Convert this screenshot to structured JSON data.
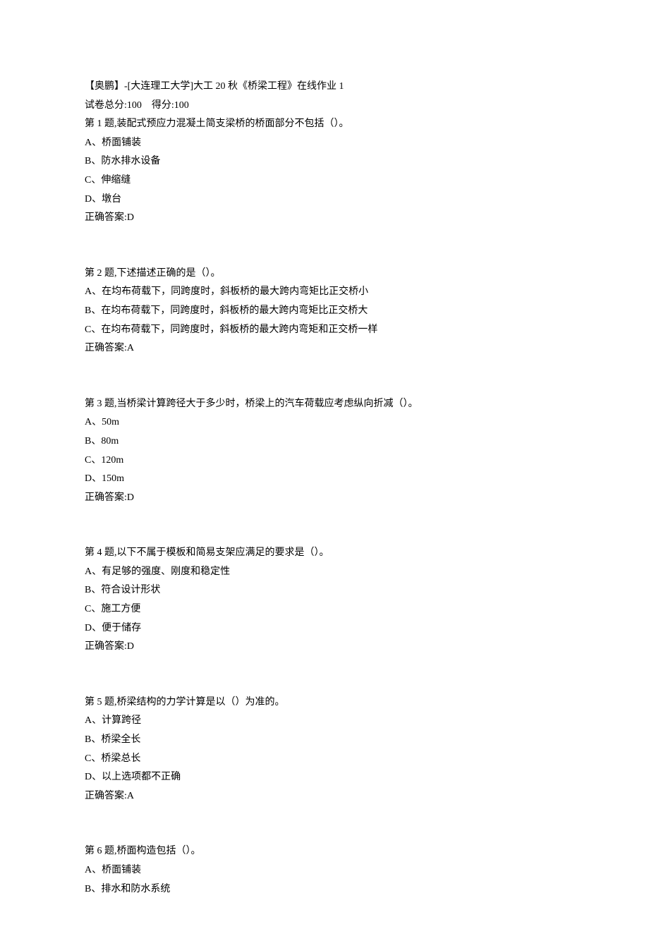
{
  "header": {
    "title_line": "【奥鹏】-[大连理工大学]大工 20 秋《桥梁工程》在线作业 1",
    "score_line": "试卷总分:100    得分:100"
  },
  "questions": [
    {
      "stem": "第 1 题,装配式预应力混凝土简支梁桥的桥面部分不包括（）。",
      "options": [
        "A、桥面铺装",
        "B、防水排水设备",
        "C、伸缩缝",
        "D、墩台"
      ],
      "answer": "正确答案:D"
    },
    {
      "stem": "第 2 题,下述描述正确的是（）。",
      "options": [
        "A、在均布荷载下，同跨度时，斜板桥的最大跨内弯矩比正交桥小",
        "B、在均布荷载下，同跨度时，斜板桥的最大跨内弯矩比正交桥大",
        "C、在均布荷载下，同跨度时，斜板桥的最大跨内弯矩和正交桥一样"
      ],
      "answer": "正确答案:A"
    },
    {
      "stem": "第 3 题,当桥梁计算跨径大于多少时，桥梁上的汽车荷载应考虑纵向折减（）。",
      "options": [
        "A、50m",
        "B、80m",
        "C、120m",
        "D、150m"
      ],
      "answer": "正确答案:D"
    },
    {
      "stem": "第 4 题,以下不属于模板和简易支架应满足的要求是（）。",
      "options": [
        "A、有足够的强度、刚度和稳定性",
        "B、符合设计形状",
        "C、施工方便",
        "D、便于储存"
      ],
      "answer": "正确答案:D"
    },
    {
      "stem": "第 5 题,桥梁结构的力学计算是以（）为准的。",
      "options": [
        "A、计算跨径",
        "B、桥梁全长",
        "C、桥梁总长",
        "D、以上选项都不正确"
      ],
      "answer": "正确答案:A"
    },
    {
      "stem": "第 6 题,桥面构造包括（）。",
      "options": [
        "A、桥面铺装",
        "B、排水和防水系统"
      ],
      "answer": ""
    }
  ]
}
